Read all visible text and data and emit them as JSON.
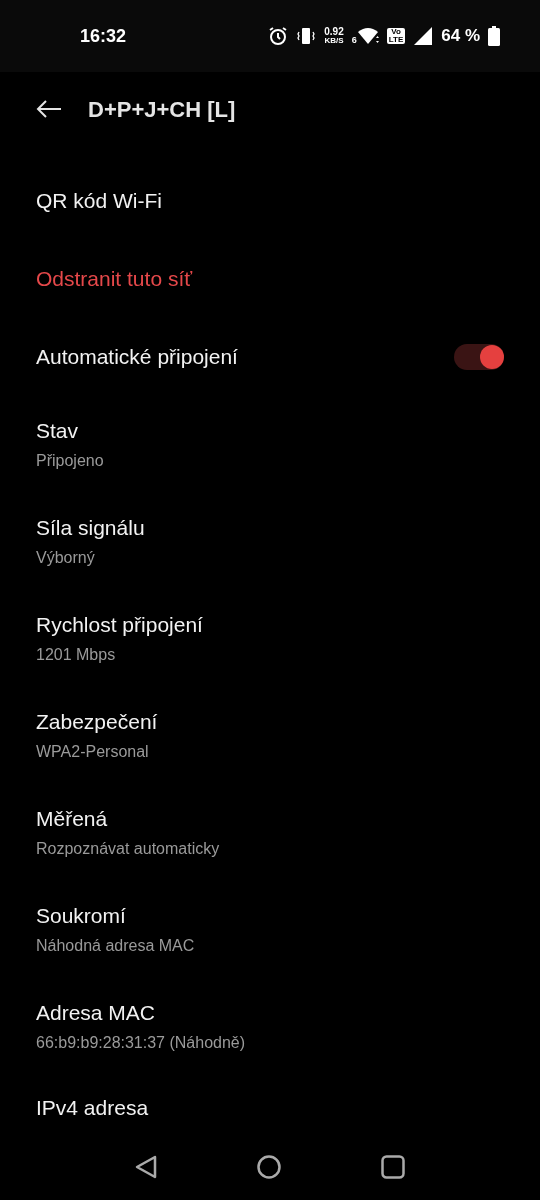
{
  "status_bar": {
    "time": "16:32",
    "speed_value": "0.92",
    "speed_unit": "KB/S",
    "wifi_band": "6",
    "volte_top": "Vo",
    "volte_bottom": "LTE",
    "battery": "64 %"
  },
  "header": {
    "title": "D+P+J+CH [L]"
  },
  "items": [
    {
      "kind": "action",
      "title": "QR kód Wi-Fi"
    },
    {
      "kind": "destructive",
      "title": "Odstranit tuto síť"
    },
    {
      "kind": "toggle",
      "title": "Automatické připojení",
      "on": true
    },
    {
      "kind": "info",
      "title": "Stav",
      "subtitle": "Připojeno"
    },
    {
      "kind": "info",
      "title": "Síla signálu",
      "subtitle": "Výborný"
    },
    {
      "kind": "info",
      "title": "Rychlost připojení",
      "subtitle": "1201 Mbps"
    },
    {
      "kind": "info",
      "title": "Zabezpečení",
      "subtitle": "WPA2-Personal"
    },
    {
      "kind": "info",
      "title": "Měřená",
      "subtitle": "Rozpoznávat automaticky"
    },
    {
      "kind": "info",
      "title": "Soukromí",
      "subtitle": "Náhodná adresa MAC"
    },
    {
      "kind": "info",
      "title": "Adresa MAC",
      "subtitle": "66:b9:b9:28:31:37 (Náhodně)"
    },
    {
      "kind": "info",
      "title": "IPv4 adresa"
    }
  ]
}
